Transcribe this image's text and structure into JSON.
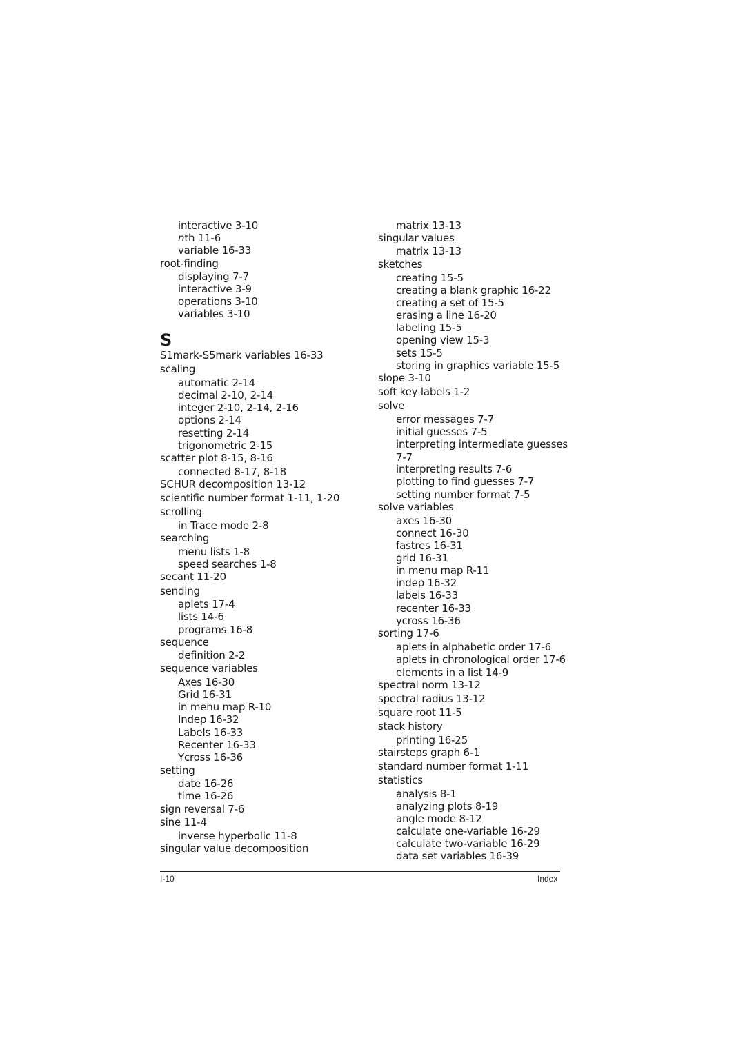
{
  "document": {
    "left_column": [
      {
        "text": "interactive 3-10",
        "level": 2
      },
      {
        "text": "nth 11-6",
        "level": 2,
        "italic_prefix": "n",
        "rest": "th 11-6"
      },
      {
        "text": "variable 16-33",
        "level": 2
      },
      {
        "text": "root-finding",
        "level": 1
      },
      {
        "text": "displaying 7-7",
        "level": 2
      },
      {
        "text": "interactive 3-9",
        "level": 2
      },
      {
        "text": "operations 3-10",
        "level": 2
      },
      {
        "text": "variables 3-10",
        "level": 2
      },
      {
        "text": "S",
        "level": 0
      },
      {
        "text": "S1mark-S5mark variables 16-33",
        "level": 1
      },
      {
        "text": "scaling",
        "level": 1
      },
      {
        "text": "automatic 2-14",
        "level": 2
      },
      {
        "text": "decimal 2-10, 2-14",
        "level": 2
      },
      {
        "text": "integer 2-10, 2-14, 2-16",
        "level": 2
      },
      {
        "text": "options 2-14",
        "level": 2
      },
      {
        "text": "resetting 2-14",
        "level": 2
      },
      {
        "text": "trigonometric 2-15",
        "level": 2
      },
      {
        "text": "scatter plot 8-15, 8-16",
        "level": 1
      },
      {
        "text": "connected 8-17, 8-18",
        "level": 2
      },
      {
        "text": "SCHUR decomposition 13-12",
        "level": 1
      },
      {
        "text": "scientific number format 1-11, 1-20",
        "level": 1
      },
      {
        "text": "scrolling",
        "level": 1
      },
      {
        "text": "in Trace mode 2-8",
        "level": 2
      },
      {
        "text": "searching",
        "level": 1
      },
      {
        "text": "menu lists 1-8",
        "level": 2
      },
      {
        "text": "speed searches 1-8",
        "level": 2
      },
      {
        "text": "secant 11-20",
        "level": 1
      },
      {
        "text": "sending",
        "level": 1
      },
      {
        "text": "aplets 17-4",
        "level": 2
      },
      {
        "text": "lists 14-6",
        "level": 2
      },
      {
        "text": "programs 16-8",
        "level": 2
      },
      {
        "text": "sequence",
        "level": 1
      },
      {
        "text": "definition 2-2",
        "level": 2
      },
      {
        "text": "sequence variables",
        "level": 1
      },
      {
        "text": "Axes 16-30",
        "level": 2
      },
      {
        "text": "Grid 16-31",
        "level": 2
      },
      {
        "text": "in menu map R-10",
        "level": 2
      },
      {
        "text": "Indep 16-32",
        "level": 2
      },
      {
        "text": "Labels 16-33",
        "level": 2
      },
      {
        "text": "Recenter 16-33",
        "level": 2
      },
      {
        "text": "Ycross 16-36",
        "level": 2
      },
      {
        "text": "setting",
        "level": 1
      },
      {
        "text": "date 16-26",
        "level": 2
      },
      {
        "text": "time 16-26",
        "level": 2
      },
      {
        "text": "sign reversal 7-6",
        "level": 1
      },
      {
        "text": "sine 11-4",
        "level": 1
      },
      {
        "text": "inverse hyperbolic 11-8",
        "level": 2
      },
      {
        "text": "singular value decomposition",
        "level": 1
      }
    ],
    "right_column": [
      {
        "text": "matrix 13-13",
        "level": 2
      },
      {
        "text": "singular values",
        "level": 1
      },
      {
        "text": "matrix 13-13",
        "level": 2
      },
      {
        "text": "sketches",
        "level": 1
      },
      {
        "text": "creating 15-5",
        "level": 2
      },
      {
        "text": "creating a blank graphic 16-22",
        "level": 2
      },
      {
        "text": "creating a set of 15-5",
        "level": 2
      },
      {
        "text": "erasing a line 16-20",
        "level": 2
      },
      {
        "text": "labeling 15-5",
        "level": 2
      },
      {
        "text": "opening view 15-3",
        "level": 2
      },
      {
        "text": "sets 15-5",
        "level": 2
      },
      {
        "text": "storing in graphics variable 15-5",
        "level": 2
      },
      {
        "text": "slope 3-10",
        "level": 1
      },
      {
        "text": "soft key labels 1-2",
        "level": 1
      },
      {
        "text": "solve",
        "level": 1
      },
      {
        "text": "error messages 7-7",
        "level": 2
      },
      {
        "text": "initial guesses 7-5",
        "level": 2
      },
      {
        "text": "interpreting intermediate guesses",
        "level": 2
      },
      {
        "text": "7-7",
        "level": 2
      },
      {
        "text": "interpreting results 7-6",
        "level": 2
      },
      {
        "text": "plotting to find guesses 7-7",
        "level": 2
      },
      {
        "text": "setting number format 7-5",
        "level": 2
      },
      {
        "text": "solve variables",
        "level": 1
      },
      {
        "text": "axes 16-30",
        "level": 2
      },
      {
        "text": "connect 16-30",
        "level": 2
      },
      {
        "text": "fastres 16-31",
        "level": 2
      },
      {
        "text": "grid 16-31",
        "level": 2
      },
      {
        "text": "in menu map R-11",
        "level": 2
      },
      {
        "text": "indep 16-32",
        "level": 2
      },
      {
        "text": "labels 16-33",
        "level": 2
      },
      {
        "text": "recenter 16-33",
        "level": 2
      },
      {
        "text": "ycross 16-36",
        "level": 2
      },
      {
        "text": "sorting 17-6",
        "level": 1
      },
      {
        "text": "aplets in alphabetic order 17-6",
        "level": 2
      },
      {
        "text": "aplets in chronological order 17-6",
        "level": 2
      },
      {
        "text": "elements in a list 14-9",
        "level": 2
      },
      {
        "text": "spectral norm 13-12",
        "level": 1
      },
      {
        "text": "spectral radius 13-12",
        "level": 1
      },
      {
        "text": "square root 11-5",
        "level": 1
      },
      {
        "text": "stack history",
        "level": 1
      },
      {
        "text": "printing 16-25",
        "level": 2
      },
      {
        "text": "stairsteps graph 6-1",
        "level": 1
      },
      {
        "text": "standard number format 1-11",
        "level": 1
      },
      {
        "text": "statistics",
        "level": 1
      },
      {
        "text": "analysis 8-1",
        "level": 2
      },
      {
        "text": "analyzing plots 8-19",
        "level": 2
      },
      {
        "text": "angle mode 8-12",
        "level": 2
      },
      {
        "text": "calculate one-variable 16-29",
        "level": 2
      },
      {
        "text": "calculate two-variable 16-29",
        "level": 2
      },
      {
        "text": "data set variables 16-39",
        "level": 2
      }
    ],
    "footer": {
      "page_number": "I-10",
      "section": "Index"
    }
  }
}
